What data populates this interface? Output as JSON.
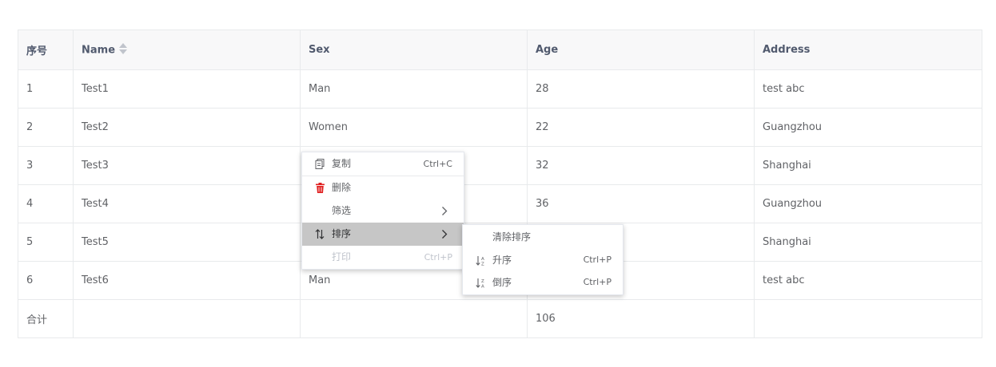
{
  "table": {
    "headers": [
      "序号",
      "Name",
      "Sex",
      "Age",
      "Address"
    ],
    "rows": [
      [
        "1",
        "Test1",
        "Man",
        "28",
        "test abc"
      ],
      [
        "2",
        "Test2",
        "Women",
        "22",
        "Guangzhou"
      ],
      [
        "3",
        "Test3",
        "",
        "32",
        "Shanghai"
      ],
      [
        "4",
        "Test4",
        "",
        "36",
        "Guangzhou"
      ],
      [
        "5",
        "Test5",
        "",
        "",
        "Shanghai"
      ],
      [
        "6",
        "Test6",
        "Man",
        "",
        "test abc"
      ]
    ],
    "footer": [
      "合计",
      "",
      "",
      "106",
      ""
    ]
  },
  "context_menu": {
    "items": [
      {
        "label": "复制",
        "shortcut": "Ctrl+C",
        "icon": "copy-icon"
      },
      {
        "label": "删除",
        "shortcut": "",
        "icon": "trash-icon"
      },
      {
        "label": "筛选",
        "shortcut": "",
        "icon": ""
      },
      {
        "label": "排序",
        "shortcut": "",
        "icon": "sort-icon"
      },
      {
        "label": "打印",
        "shortcut": "Ctrl+P",
        "icon": ""
      }
    ]
  },
  "submenu": {
    "items": [
      {
        "label": "清除排序",
        "shortcut": "",
        "icon": ""
      },
      {
        "label": "升序",
        "shortcut": "Ctrl+P",
        "icon": "sort-ascending-icon"
      },
      {
        "label": "倒序",
        "shortcut": "Ctrl+P",
        "icon": "sort-descending-icon"
      }
    ]
  },
  "colors": {
    "delete_icon": "#e02020",
    "active_item": "#c6c6c6",
    "header_bg": "#f8f8f9",
    "border": "#e8eaec"
  }
}
